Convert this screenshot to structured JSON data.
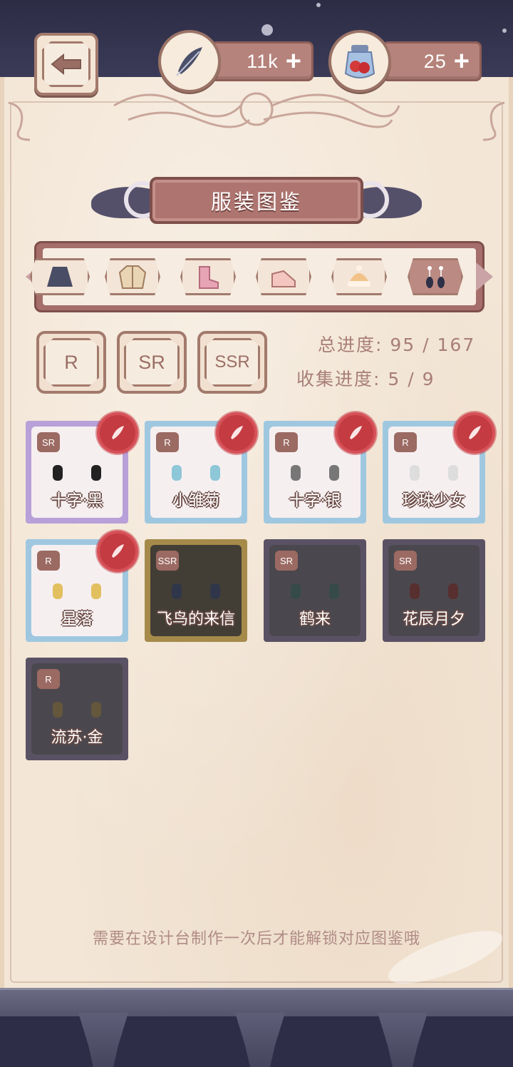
{
  "currencies": {
    "feather": {
      "value": "11k",
      "icon": "feather-icon"
    },
    "potion": {
      "value": "25",
      "icon": "potion-jar-icon"
    }
  },
  "title": "服装图鉴",
  "categories": [
    {
      "name": "skirt",
      "icon": "skirt-icon",
      "active": false
    },
    {
      "name": "jacket",
      "icon": "jacket-icon",
      "active": false
    },
    {
      "name": "socks",
      "icon": "socks-icon",
      "active": false
    },
    {
      "name": "shoes",
      "icon": "shoes-icon",
      "active": false
    },
    {
      "name": "hat",
      "icon": "hat-icon",
      "active": false
    },
    {
      "name": "earrings",
      "icon": "earrings-icon",
      "active": true
    }
  ],
  "rarity_filters": [
    "R",
    "SR",
    "SSR"
  ],
  "progress": {
    "total_label": "总进度:",
    "total_value": "95 / 167",
    "collect_label": "收集进度:",
    "collect_value": "5 / 9"
  },
  "items": [
    {
      "name": "十字·黑",
      "rarity": "SR",
      "unlocked": true,
      "new": true,
      "earring_color": "#222222",
      "frame": "#b8a0d8"
    },
    {
      "name": "小雏菊",
      "rarity": "R",
      "unlocked": true,
      "new": true,
      "earring_color": "#8ec7d8",
      "frame": "#9fc8e0"
    },
    {
      "name": "十字·银",
      "rarity": "R",
      "unlocked": true,
      "new": true,
      "earring_color": "#777777",
      "frame": "#9fc8e0"
    },
    {
      "name": "珍珠少女",
      "rarity": "R",
      "unlocked": true,
      "new": true,
      "earring_color": "#dddddd",
      "frame": "#9fc8e0"
    },
    {
      "name": "星落",
      "rarity": "R",
      "unlocked": true,
      "new": true,
      "earring_color": "#e2c060",
      "frame": "#9fc8e0"
    },
    {
      "name": "飞鸟的来信",
      "rarity": "SSR",
      "unlocked": false,
      "new": false,
      "earring_color": "#3a4a6a",
      "frame": "#d9b866"
    },
    {
      "name": "鹤来",
      "rarity": "SR",
      "unlocked": false,
      "new": false,
      "earring_color": "#4a7a6a",
      "frame": "#6a5a7a"
    },
    {
      "name": "花辰月夕",
      "rarity": "SR",
      "unlocked": false,
      "new": false,
      "earring_color": "#9a3a2a",
      "frame": "#6a5a7a"
    },
    {
      "name": "流苏·金",
      "rarity": "R",
      "unlocked": false,
      "new": false,
      "earring_color": "#b89a4a",
      "frame": "#6a6a6a"
    }
  ],
  "hint": "需要在设计台制作一次后才能解锁对应图鉴哦",
  "colors": {
    "parchment": "#f3e6d6",
    "accent": "#ae7570",
    "seal": "#c43b42"
  }
}
